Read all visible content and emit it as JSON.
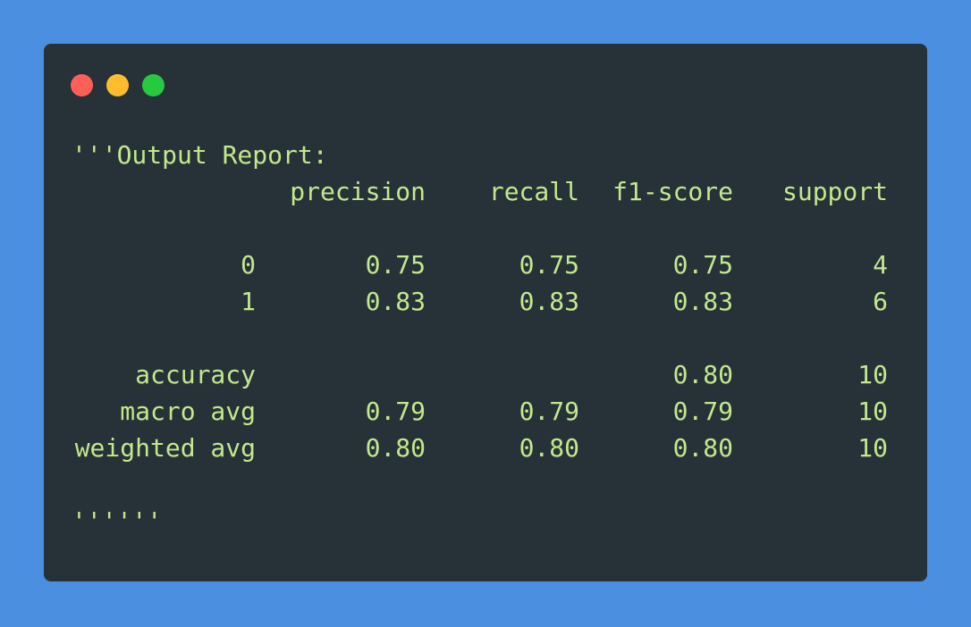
{
  "window": {
    "controls": [
      "close",
      "minimize",
      "maximize"
    ]
  },
  "report": {
    "open": "'''Output Report:",
    "headers": [
      "precision",
      "recall",
      "f1-score",
      "support"
    ],
    "rows": [
      {
        "label": "0",
        "precision": "0.75",
        "recall": "0.75",
        "f1": "0.75",
        "support": "4"
      },
      {
        "label": "1",
        "precision": "0.83",
        "recall": "0.83",
        "f1": "0.83",
        "support": "6"
      }
    ],
    "summary": [
      {
        "label": "accuracy",
        "precision": "",
        "recall": "",
        "f1": "0.80",
        "support": "10"
      },
      {
        "label": "macro avg",
        "precision": "0.79",
        "recall": "0.79",
        "f1": "0.79",
        "support": "10"
      },
      {
        "label": "weighted avg",
        "precision": "0.80",
        "recall": "0.80",
        "f1": "0.80",
        "support": "10"
      }
    ],
    "close": "''''''"
  },
  "colors": {
    "background": "#4a8fe0",
    "window": "#263238",
    "text": "#c3e88d",
    "close_dot": "#ff5f56",
    "minimize_dot": "#ffbd2e",
    "maximize_dot": "#27c93f"
  }
}
